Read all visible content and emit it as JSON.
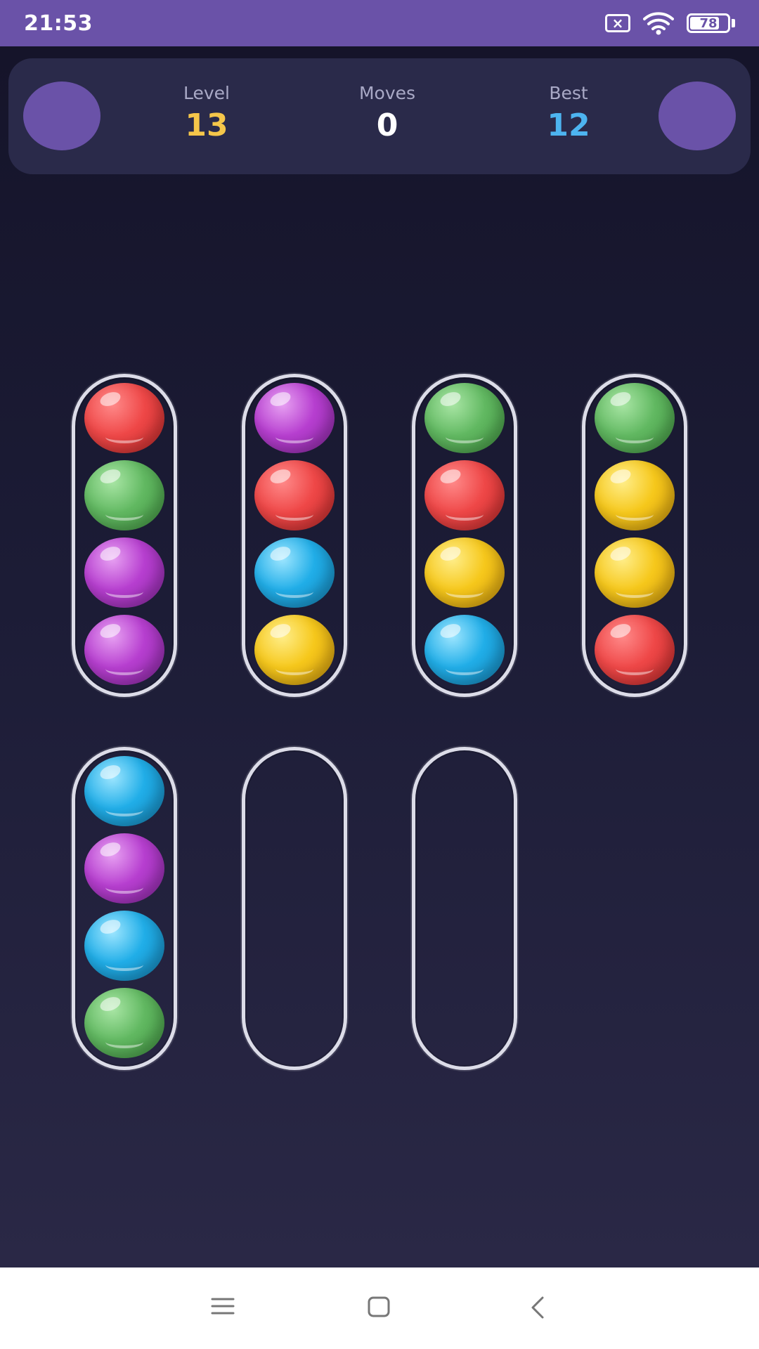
{
  "status_bar": {
    "time": "21:53",
    "sim_icon": "sim-x-icon",
    "wifi_icon": "wifi-icon",
    "battery_level": "78",
    "battery_fraction": 0.78
  },
  "header": {
    "left_button_icon": "circle-button",
    "right_button_icon": "circle-button",
    "level_label": "Level",
    "level_value": "13",
    "moves_label": "Moves",
    "moves_value": "0",
    "best_label": "Best",
    "best_value": "12"
  },
  "colors": {
    "level_value": "#f5c64a",
    "moves_value": "#ffffff",
    "best_value": "#4db4f0",
    "accent": "#6a52a8"
  },
  "tubes": [
    {
      "balls": [
        "red",
        "green",
        "purple",
        "purple"
      ]
    },
    {
      "balls": [
        "purple",
        "red",
        "cyan",
        "yellow"
      ]
    },
    {
      "balls": [
        "green",
        "red",
        "yellow",
        "cyan"
      ]
    },
    {
      "balls": [
        "green",
        "yellow",
        "yellow",
        "red"
      ]
    },
    {
      "balls": [
        "cyan",
        "purple",
        "cyan",
        "green"
      ]
    },
    {
      "balls": []
    },
    {
      "balls": []
    }
  ],
  "nav_bar": {
    "menu_icon": "menu-icon",
    "home_icon": "home-icon",
    "back_icon": "back-icon"
  }
}
